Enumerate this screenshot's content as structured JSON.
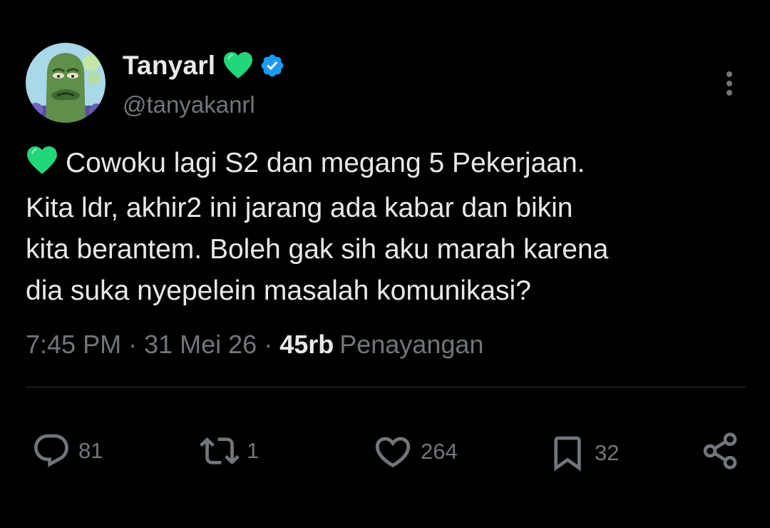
{
  "author": {
    "display_name": "Tanyarl",
    "handle": "@tanyakanrl",
    "verified": true,
    "avatar_icon": "fish-character-avatar"
  },
  "tweet": {
    "emoji": "green-heart",
    "text": "Cowoku lagi S2 dan megang 5 Pekerjaan.\nKita ldr, akhir2 ini jarang ada kabar dan bikin\nkita berantem. Boleh gak sih aku marah karena\ndia suka nyepelein masalah komunikasi?",
    "time": "7:45 PM",
    "date": "31 Mei 26",
    "views_count": "45rb",
    "views_label": "Penayangan"
  },
  "actions": {
    "replies": "81",
    "retweets": "1",
    "likes": "264",
    "bookmarks": "32"
  },
  "colors": {
    "background": "#000000",
    "primary_text": "#e7e9ea",
    "secondary_text": "#71767b",
    "verified_blue": "#1d9bf0",
    "heart_green": "#22d67a",
    "divider": "#2f3336"
  }
}
